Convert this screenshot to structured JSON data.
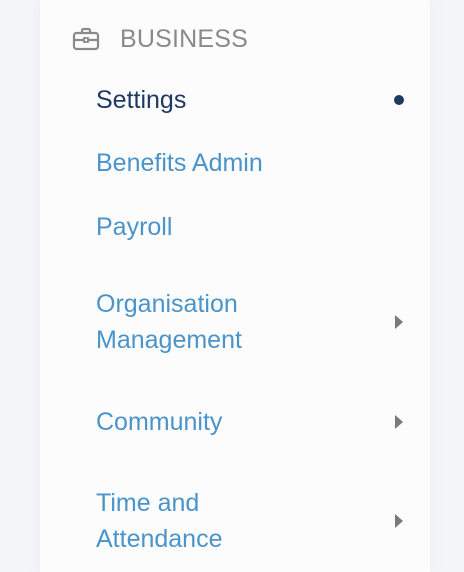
{
  "section": {
    "icon": "briefcase-icon",
    "title": "BUSINESS"
  },
  "nav": {
    "items": [
      {
        "line1": "Settings",
        "line2": "",
        "state": "active"
      },
      {
        "line1": "Benefits Admin",
        "line2": ""
      },
      {
        "line1": "Payroll",
        "line2": ""
      },
      {
        "line1": "Organisation",
        "line2": "Management",
        "submenu": true
      },
      {
        "line1": "Community",
        "line2": "",
        "submenu": true
      },
      {
        "line1": "Time and",
        "line2": "Attendance",
        "submenu": true
      }
    ]
  },
  "colors": {
    "link": "#4a94c9",
    "active": "#1e3a62",
    "header": "#8a8a8a",
    "chevron": "#7a7a7a"
  }
}
